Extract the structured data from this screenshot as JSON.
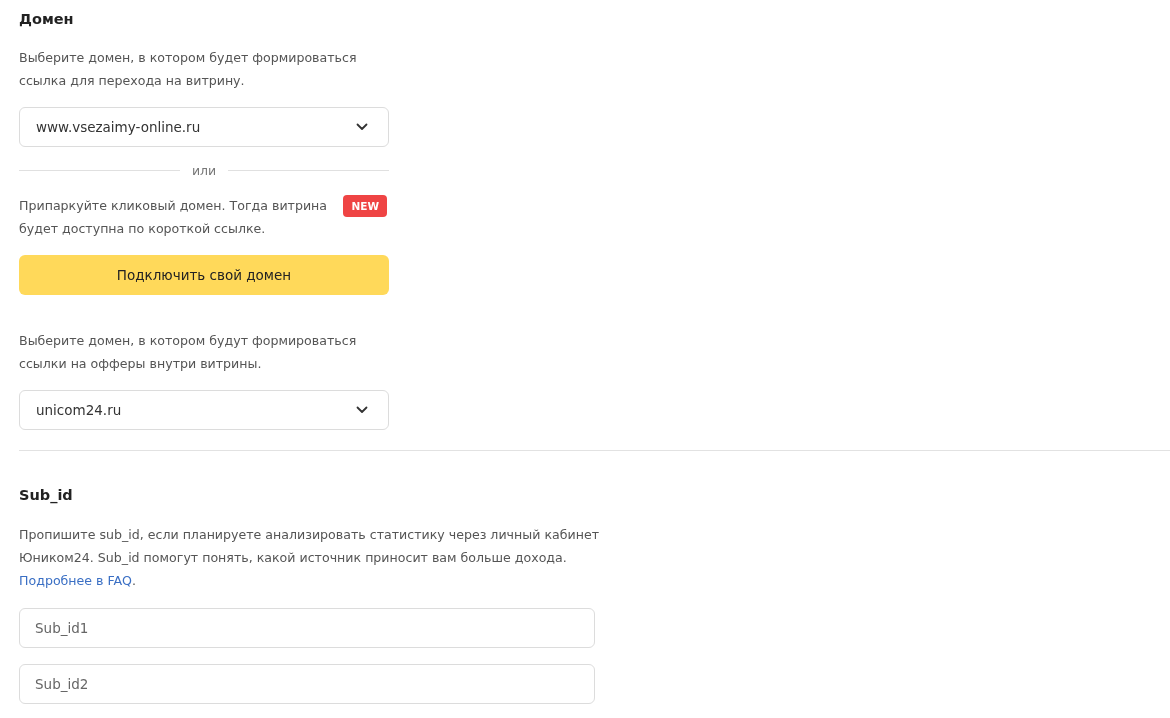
{
  "domain_section": {
    "title": "Домен",
    "showcase_hint": "Выберите домен, в котором будет формироваться ссылка для перехода на витрину.",
    "showcase_select": {
      "value": "www.vsezaimy-online.ru"
    },
    "divider_label": "или",
    "park_hint": "Припаркуйте кликовый домен. Тогда витрина будет доступна по короткой ссылке.",
    "park_badge": "NEW",
    "connect_button": "Подключить свой домен",
    "offers_hint": "Выберите домен, в котором будут формироваться ссылки на офферы внутри витрины.",
    "offers_select": {
      "value": "unicom24.ru"
    }
  },
  "sub_id_section": {
    "title": "Sub_id",
    "description": {
      "text": "Пропишите sub_id, если планируете анализировать статистику через личный кабинет Юником24. Sub_id помогут понять, какой источник приносит вам больше дохода. ",
      "link": "Подробнее в FAQ",
      "text_after": "."
    },
    "fields": [
      {
        "placeholder": "Sub_id1"
      },
      {
        "placeholder": "Sub_id2"
      }
    ]
  }
}
